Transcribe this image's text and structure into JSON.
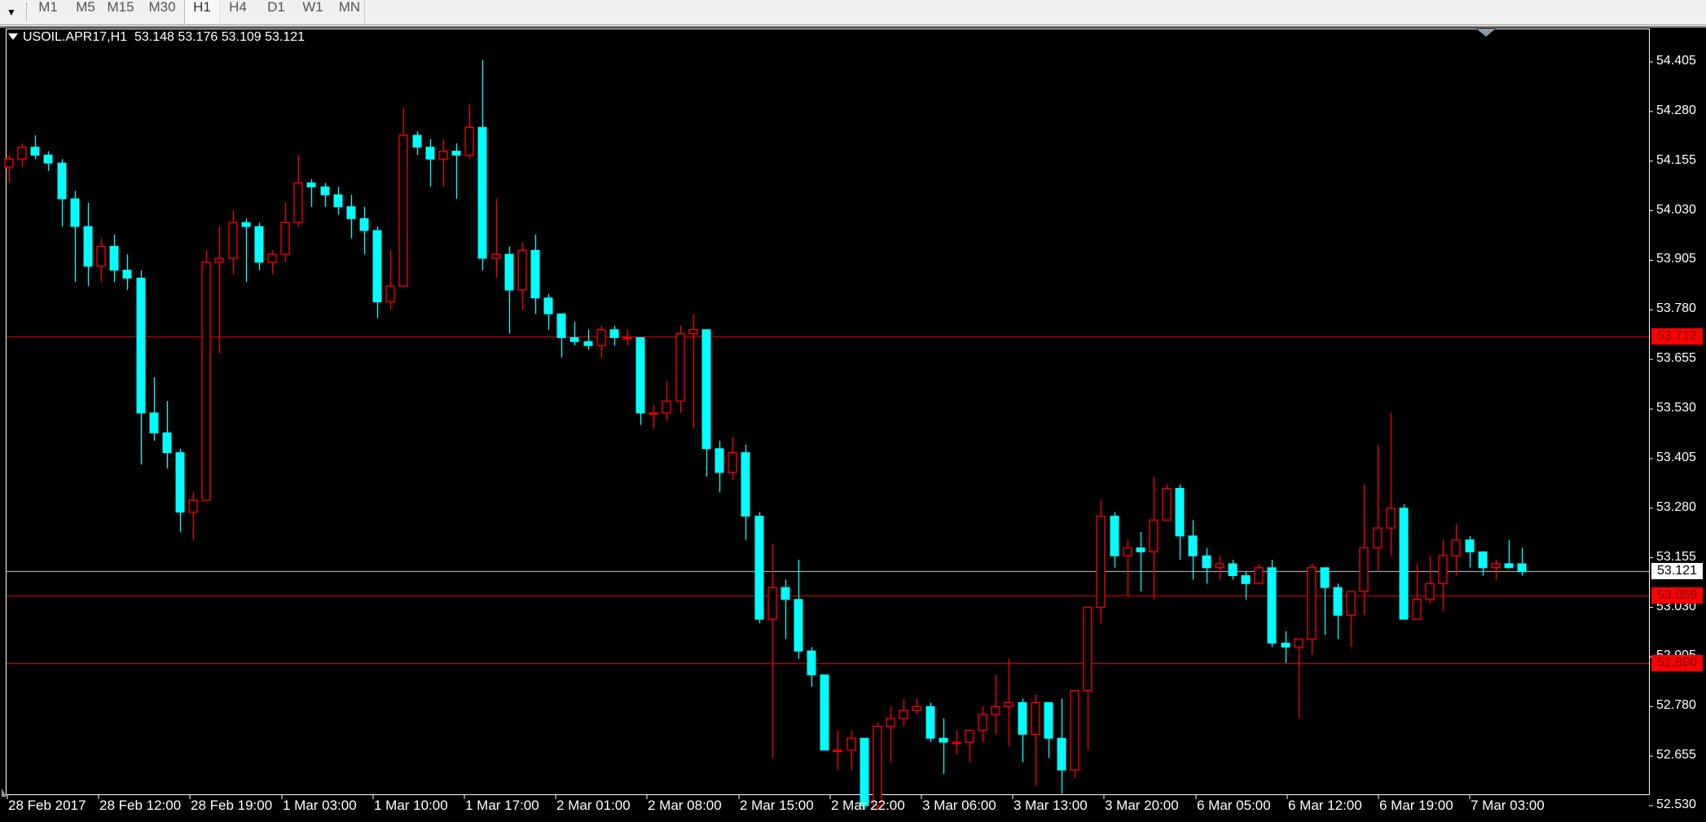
{
  "toolbar": {
    "menu_icon": "chevron-down-icon",
    "timeframes": [
      {
        "label": "M1",
        "active": false
      },
      {
        "label": "M5",
        "active": false
      },
      {
        "label": "M15",
        "active": false
      },
      {
        "label": "M30",
        "active": false
      },
      {
        "label": "H1",
        "active": true
      },
      {
        "label": "H4",
        "active": false
      },
      {
        "label": "D1",
        "active": false
      },
      {
        "label": "W1",
        "active": false
      },
      {
        "label": "MN",
        "active": false
      }
    ]
  },
  "colors": {
    "background": "#000000",
    "bull_outline": "#ff0000",
    "bear_fill": "#00ffff",
    "level_line": "#c00000",
    "bid_line": "#a0a0a0",
    "axis_text": "#ffffff",
    "tag_red": "#ff0000",
    "tag_white": "#ffffff"
  },
  "chart_data": {
    "type": "candlestick",
    "title": "USOIL.APR17,H1",
    "symbol": "USOIL.APR17",
    "timeframe": "H1",
    "ohlc_header": {
      "open": "53.148",
      "high": "53.176",
      "low": "53.109",
      "close": "53.121"
    },
    "title_text": "USOIL.APR17,H1  53.148 53.176 53.109 53.121",
    "ylim": [
      52.485,
      54.49
    ],
    "y_ticks": [
      "54.405",
      "54.280",
      "54.155",
      "54.030",
      "53.905",
      "53.780",
      "53.655",
      "53.530",
      "53.405",
      "53.280",
      "53.155",
      "53.030",
      "52.905",
      "52.780",
      "52.655",
      "52.530"
    ],
    "x_ticks": [
      "28 Feb 2017",
      "28 Feb 12:00",
      "28 Feb 19:00",
      "1 Mar 03:00",
      "1 Mar 10:00",
      "1 Mar 17:00",
      "2 Mar 01:00",
      "2 Mar 08:00",
      "2 Mar 15:00",
      "2 Mar 22:00",
      "3 Mar 06:00",
      "3 Mar 13:00",
      "3 Mar 20:00",
      "6 Mar 05:00",
      "6 Mar 12:00",
      "6 Mar 19:00",
      "7 Mar 03:00"
    ],
    "horizontal_levels": [
      {
        "price": 53.712,
        "label": "53.712",
        "kind": "level"
      },
      {
        "price": 53.059,
        "label": "53.059",
        "kind": "level"
      },
      {
        "price": 52.89,
        "label": "52.890",
        "kind": "level"
      },
      {
        "price": 53.121,
        "label": "53.121",
        "kind": "bid"
      }
    ],
    "candles": [
      [
        54.14,
        54.17,
        54.1,
        54.16
      ],
      [
        54.16,
        54.2,
        54.14,
        54.19
      ],
      [
        54.19,
        54.22,
        54.16,
        54.17
      ],
      [
        54.17,
        54.18,
        54.13,
        54.15
      ],
      [
        54.15,
        54.16,
        53.99,
        54.06
      ],
      [
        54.06,
        54.08,
        53.85,
        53.99
      ],
      [
        53.99,
        54.05,
        53.84,
        53.89
      ],
      [
        53.89,
        53.96,
        53.85,
        53.94
      ],
      [
        53.94,
        53.97,
        53.85,
        53.88
      ],
      [
        53.88,
        53.92,
        53.83,
        53.86
      ],
      [
        53.86,
        53.88,
        53.39,
        53.52
      ],
      [
        53.52,
        53.61,
        53.45,
        53.47
      ],
      [
        53.47,
        53.55,
        53.38,
        53.42
      ],
      [
        53.42,
        53.43,
        53.22,
        53.27
      ],
      [
        53.27,
        53.32,
        53.2,
        53.3
      ],
      [
        53.3,
        53.93,
        53.3,
        53.9
      ],
      [
        53.9,
        53.99,
        53.67,
        53.91
      ],
      [
        53.91,
        54.03,
        53.87,
        54.0
      ],
      [
        54.0,
        54.01,
        53.85,
        53.99
      ],
      [
        53.99,
        54.0,
        53.88,
        53.9
      ],
      [
        53.9,
        53.93,
        53.87,
        53.92
      ],
      [
        53.92,
        54.05,
        53.9,
        54.0
      ],
      [
        54.0,
        54.17,
        53.99,
        54.1
      ],
      [
        54.1,
        54.11,
        54.04,
        54.09
      ],
      [
        54.09,
        54.1,
        54.04,
        54.07
      ],
      [
        54.07,
        54.09,
        54.02,
        54.04
      ],
      [
        54.04,
        54.07,
        53.96,
        54.01
      ],
      [
        54.01,
        54.04,
        53.92,
        53.98
      ],
      [
        53.98,
        53.99,
        53.76,
        53.8
      ],
      [
        53.8,
        53.93,
        53.78,
        53.84
      ],
      [
        53.84,
        54.29,
        53.84,
        54.22
      ],
      [
        54.22,
        54.23,
        54.17,
        54.19
      ],
      [
        54.19,
        54.21,
        54.09,
        54.16
      ],
      [
        54.16,
        54.21,
        54.09,
        54.18
      ],
      [
        54.18,
        54.2,
        54.06,
        54.17
      ],
      [
        54.17,
        54.3,
        54.16,
        54.24
      ],
      [
        54.24,
        54.41,
        53.88,
        53.91
      ],
      [
        53.91,
        54.06,
        53.86,
        53.92
      ],
      [
        53.92,
        53.94,
        53.72,
        53.83
      ],
      [
        53.83,
        53.95,
        53.78,
        53.93
      ],
      [
        53.93,
        53.97,
        53.77,
        53.81
      ],
      [
        53.81,
        53.82,
        53.73,
        53.77
      ],
      [
        53.77,
        53.77,
        53.66,
        53.71
      ],
      [
        53.71,
        53.75,
        53.69,
        53.7
      ],
      [
        53.7,
        53.73,
        53.68,
        53.69
      ],
      [
        53.69,
        53.74,
        53.66,
        53.73
      ],
      [
        53.73,
        53.74,
        53.69,
        53.71
      ],
      [
        53.71,
        53.73,
        53.69,
        53.71
      ],
      [
        53.71,
        53.71,
        53.49,
        53.52
      ],
      [
        53.52,
        53.54,
        53.48,
        53.52
      ],
      [
        53.52,
        53.6,
        53.5,
        53.55
      ],
      [
        53.55,
        53.74,
        53.52,
        53.72
      ],
      [
        53.72,
        53.77,
        53.48,
        53.73
      ],
      [
        53.73,
        53.73,
        53.36,
        53.43
      ],
      [
        53.43,
        53.45,
        53.32,
        53.37
      ],
      [
        53.37,
        53.46,
        53.35,
        53.42
      ],
      [
        53.42,
        53.44,
        53.2,
        53.26
      ],
      [
        53.26,
        53.27,
        52.99,
        53.0
      ],
      [
        53.0,
        53.19,
        52.65,
        53.08
      ],
      [
        53.08,
        53.1,
        52.95,
        53.05
      ],
      [
        53.05,
        53.15,
        52.9,
        52.92
      ],
      [
        52.92,
        52.93,
        52.83,
        52.86
      ],
      [
        52.86,
        52.86,
        52.67,
        52.67
      ],
      [
        52.67,
        52.72,
        52.62,
        52.67
      ],
      [
        52.67,
        52.72,
        52.62,
        52.7
      ],
      [
        52.7,
        52.7,
        52.52,
        52.53
      ],
      [
        52.53,
        52.74,
        52.52,
        52.73
      ],
      [
        52.73,
        52.78,
        52.64,
        52.75
      ],
      [
        52.75,
        52.8,
        52.73,
        52.77
      ],
      [
        52.77,
        52.8,
        52.76,
        52.78
      ],
      [
        52.78,
        52.79,
        52.69,
        52.7
      ],
      [
        52.7,
        52.75,
        52.61,
        52.69
      ],
      [
        52.69,
        52.72,
        52.66,
        52.69
      ],
      [
        52.69,
        52.71,
        52.64,
        52.72
      ],
      [
        52.72,
        52.78,
        52.69,
        52.76
      ],
      [
        52.76,
        52.86,
        52.71,
        52.78
      ],
      [
        52.78,
        52.9,
        52.68,
        52.79
      ],
      [
        52.79,
        52.8,
        52.64,
        52.71
      ],
      [
        52.71,
        52.81,
        52.58,
        52.79
      ],
      [
        52.79,
        52.79,
        52.65,
        52.7
      ],
      [
        52.7,
        52.8,
        52.56,
        52.62
      ],
      [
        52.62,
        52.82,
        52.6,
        52.82
      ],
      [
        52.82,
        52.95,
        52.67,
        53.03
      ],
      [
        53.03,
        53.3,
        52.99,
        53.26
      ],
      [
        53.26,
        53.27,
        53.13,
        53.16
      ],
      [
        53.16,
        53.2,
        53.06,
        53.18
      ],
      [
        53.18,
        53.22,
        53.07,
        53.17
      ],
      [
        53.17,
        53.36,
        53.05,
        53.25
      ],
      [
        53.25,
        53.34,
        53.28,
        53.33
      ],
      [
        53.33,
        53.34,
        53.15,
        53.21
      ],
      [
        53.21,
        53.25,
        53.1,
        53.16
      ],
      [
        53.16,
        53.18,
        53.09,
        53.13
      ],
      [
        53.13,
        53.16,
        53.1,
        53.14
      ],
      [
        53.14,
        53.15,
        53.1,
        53.11
      ],
      [
        53.11,
        53.12,
        53.05,
        53.09
      ],
      [
        53.09,
        53.14,
        53.09,
        53.13
      ],
      [
        53.13,
        53.15,
        52.93,
        52.94
      ],
      [
        52.94,
        52.97,
        52.89,
        52.93
      ],
      [
        52.93,
        52.95,
        52.75,
        52.95
      ],
      [
        52.95,
        53.14,
        52.91,
        53.13
      ],
      [
        53.13,
        53.12,
        52.96,
        53.08
      ],
      [
        53.08,
        53.09,
        52.95,
        53.01
      ],
      [
        53.01,
        53.07,
        52.93,
        53.07
      ],
      [
        53.07,
        53.34,
        53.01,
        53.18
      ],
      [
        53.18,
        53.44,
        53.12,
        53.23
      ],
      [
        53.23,
        53.52,
        53.16,
        53.28
      ],
      [
        53.28,
        53.29,
        53.0,
        53.0
      ],
      [
        53.0,
        53.14,
        53.05,
        53.05
      ],
      [
        53.05,
        53.16,
        53.04,
        53.09
      ],
      [
        53.09,
        53.2,
        53.02,
        53.16
      ],
      [
        53.16,
        53.24,
        53.11,
        53.2
      ],
      [
        53.2,
        53.21,
        53.13,
        53.17
      ],
      [
        53.17,
        53.17,
        53.11,
        53.13
      ],
      [
        53.13,
        53.15,
        53.1,
        53.14
      ],
      [
        53.14,
        53.2,
        53.13,
        53.13
      ],
      [
        53.14,
        53.18,
        53.11,
        53.12
      ]
    ]
  }
}
